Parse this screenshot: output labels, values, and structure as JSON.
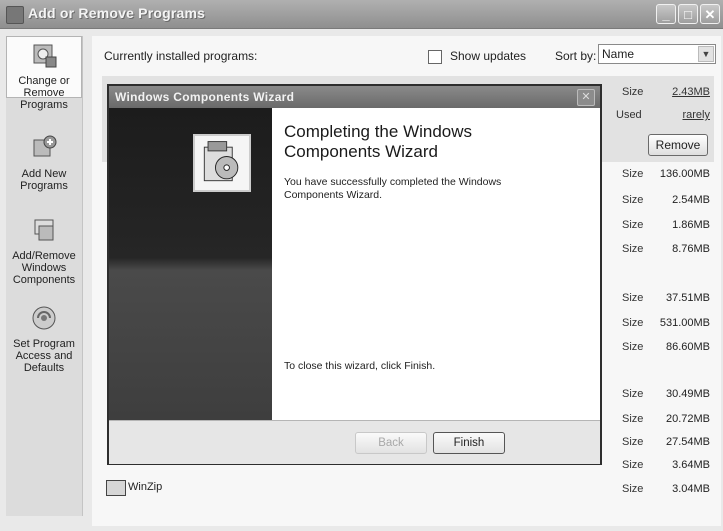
{
  "window": {
    "title": "Add or Remove Programs"
  },
  "sidebar": {
    "items": [
      {
        "label_lines": [
          "Change or",
          "Remove",
          "Programs"
        ],
        "icon": "change-remove-icon",
        "active": true
      },
      {
        "label_lines": [
          "Add New",
          "Programs"
        ],
        "icon": "add-programs-icon"
      },
      {
        "label_lines": [
          "Add/Remove",
          "Windows",
          "Components"
        ],
        "icon": "windows-components-icon"
      },
      {
        "label_lines": [
          "Set Program",
          "Access and",
          "Defaults"
        ],
        "icon": "program-access-icon"
      }
    ]
  },
  "header": {
    "currently_installed": "Currently installed programs:",
    "show_updates": "Show updates",
    "sort_by_label": "Sort by:",
    "sort_by_value": "Name"
  },
  "selected_program": {
    "size_label": "Size",
    "size_value": "2.43MB",
    "used_label": "Used",
    "used_value": "rarely",
    "remove_button": "Remove"
  },
  "program_sizes": [
    {
      "label": "Size",
      "value": "136.00MB"
    },
    {
      "label": "Size",
      "value": "2.54MB"
    },
    {
      "label": "Size",
      "value": "1.86MB"
    },
    {
      "label": "Size",
      "value": "8.76MB"
    },
    {
      "label": "Size",
      "value": "37.51MB"
    },
    {
      "label": "Size",
      "value": "531.00MB"
    },
    {
      "label": "Size",
      "value": "86.60MB"
    },
    {
      "label": "Size",
      "value": "30.49MB"
    },
    {
      "label": "Size",
      "value": "20.72MB"
    },
    {
      "label": "Size",
      "value": "27.54MB"
    },
    {
      "label": "Size",
      "value": "3.64MB"
    },
    {
      "label": "Size",
      "value": "3.04MB"
    }
  ],
  "winzip": {
    "name": "WinZip"
  },
  "wizard": {
    "title": "Windows Components Wizard",
    "heading_line1": "Completing the Windows",
    "heading_line2": "Components Wizard",
    "body": "You have successfully completed the Windows Components Wizard.",
    "footer": "To close this wizard, click Finish.",
    "back_button": "Back",
    "finish_button": "Finish"
  }
}
